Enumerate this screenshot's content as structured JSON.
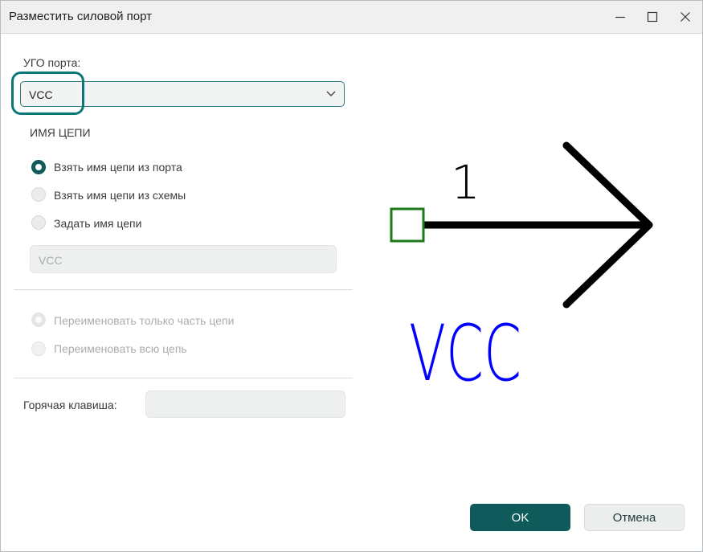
{
  "window": {
    "title": "Разместить силовой порт",
    "controls": [
      "minimize-icon",
      "maximize-icon",
      "close-icon"
    ]
  },
  "port_symbol": {
    "label": "УГО порта:",
    "selected": "VCC"
  },
  "net_name": {
    "heading": "ИМЯ ЦЕПИ",
    "options": [
      {
        "label": "Взять имя цепи из порта",
        "checked": true
      },
      {
        "label": "Взять имя цепи из схемы",
        "checked": false
      },
      {
        "label": "Задать имя цепи",
        "checked": false
      }
    ],
    "custom_value": "VCC"
  },
  "rename": {
    "options": [
      {
        "label": "Переименовать только часть цепи",
        "checked": true,
        "disabled": true
      },
      {
        "label": "Переименовать всю цепь",
        "checked": false,
        "disabled": true
      }
    ]
  },
  "hotkey": {
    "label": "Горячая клавиша:",
    "value": ""
  },
  "preview": {
    "pin_number": "1",
    "net_label": "VCC",
    "colors": {
      "symbol": "#000000",
      "pin": "#1a7a1a",
      "net_label": "#0000ff"
    }
  },
  "buttons": {
    "ok": "OK",
    "cancel": "Отмена"
  },
  "colors": {
    "accent": "#0f5b5b",
    "focus": "#0d7777"
  }
}
